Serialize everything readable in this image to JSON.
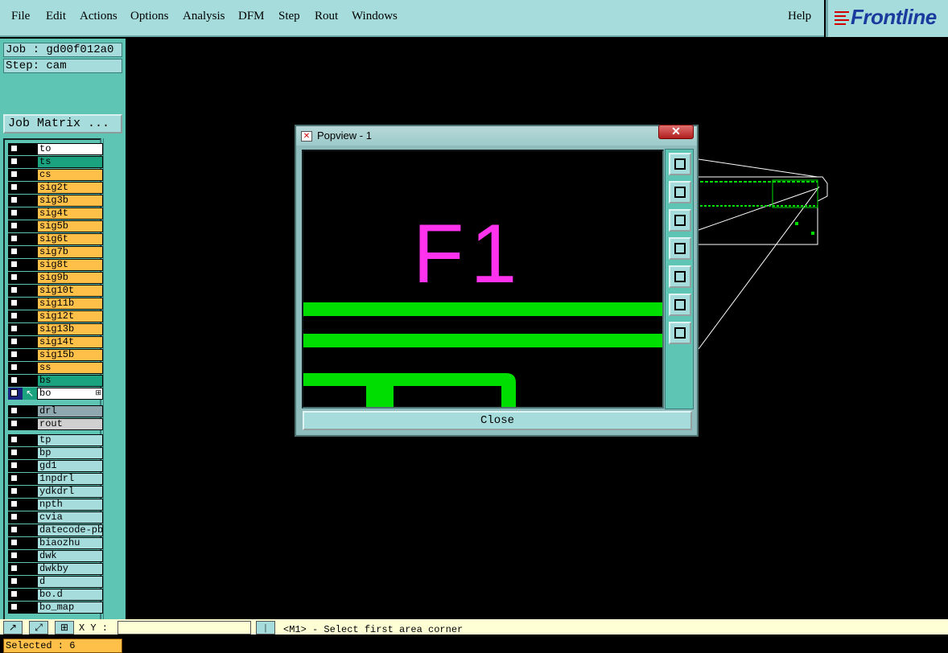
{
  "menu": {
    "items": [
      "File",
      "Edit",
      "Actions",
      "Options",
      "Analysis",
      "DFM",
      "Step",
      "Rout",
      "Windows"
    ],
    "help": "Help"
  },
  "logo": {
    "text": "Frontline"
  },
  "job": {
    "label": "Job : gd00f012a0"
  },
  "step": {
    "label": "Step: cam"
  },
  "job_matrix_button": "Job Matrix ...",
  "layers": {
    "board": [
      {
        "name": "to",
        "color": "#ffffff"
      },
      {
        "name": "ts",
        "color": "#1aa37e"
      },
      {
        "name": "cs",
        "color": "#ffc04a"
      },
      {
        "name": "sig2t",
        "color": "#ffc04a"
      },
      {
        "name": "sig3b",
        "color": "#ffc04a"
      },
      {
        "name": "sig4t",
        "color": "#ffc04a"
      },
      {
        "name": "sig5b",
        "color": "#ffc04a"
      },
      {
        "name": "sig6t",
        "color": "#ffc04a"
      },
      {
        "name": "sig7b",
        "color": "#ffc04a"
      },
      {
        "name": "sig8t",
        "color": "#ffc04a"
      },
      {
        "name": "sig9b",
        "color": "#ffc04a"
      },
      {
        "name": "sig10t",
        "color": "#ffc04a"
      },
      {
        "name": "sig11b",
        "color": "#ffc04a"
      },
      {
        "name": "sig12t",
        "color": "#ffc04a"
      },
      {
        "name": "sig13b",
        "color": "#ffc04a"
      },
      {
        "name": "sig14t",
        "color": "#ffc04a"
      },
      {
        "name": "sig15b",
        "color": "#ffc04a"
      },
      {
        "name": "ss",
        "color": "#ffc04a"
      },
      {
        "name": "bs",
        "color": "#1aa37e"
      },
      {
        "name": "bo",
        "color": "#ffffff",
        "active": true
      }
    ],
    "drill": [
      {
        "name": "drl",
        "color": "#8fa8b0"
      },
      {
        "name": "rout",
        "color": "#d0d0d0"
      }
    ],
    "misc": [
      {
        "name": "tp",
        "color": "#a6dcdc"
      },
      {
        "name": "bp",
        "color": "#a6dcdc"
      },
      {
        "name": "gd1",
        "color": "#a6dcdc"
      },
      {
        "name": "1npdrl",
        "color": "#a6dcdc"
      },
      {
        "name": "ydkdrl",
        "color": "#a6dcdc"
      },
      {
        "name": "npth",
        "color": "#a6dcdc"
      },
      {
        "name": "cvia",
        "color": "#a6dcdc"
      },
      {
        "name": "datecode-pbe",
        "color": "#a6dcdc"
      },
      {
        "name": "biaozhu",
        "color": "#a6dcdc"
      },
      {
        "name": "dwk",
        "color": "#a6dcdc"
      },
      {
        "name": "dwkby",
        "color": "#a6dcdc"
      },
      {
        "name": "d",
        "color": "#a6dcdc"
      },
      {
        "name": "bo.d",
        "color": "#a6dcdc"
      },
      {
        "name": "bo_map",
        "color": "#a6dcdc"
      }
    ]
  },
  "selected": "Selected : 6",
  "status": {
    "xy_label": "X Y :",
    "coord_value": "",
    "message": "<M1> - Select first area corner"
  },
  "popview": {
    "title": "Popview - 1",
    "close_label": "Close",
    "text_mark": "F1",
    "text_color": "#ff33ee",
    "trace_color": "#00dd00",
    "tools": [
      "zoom-window-icon",
      "pan-up-icon",
      "pan-down-icon",
      "pan-left-icon",
      "pan-right-icon",
      "zoom-home-icon",
      "zoom-fit-icon"
    ]
  }
}
